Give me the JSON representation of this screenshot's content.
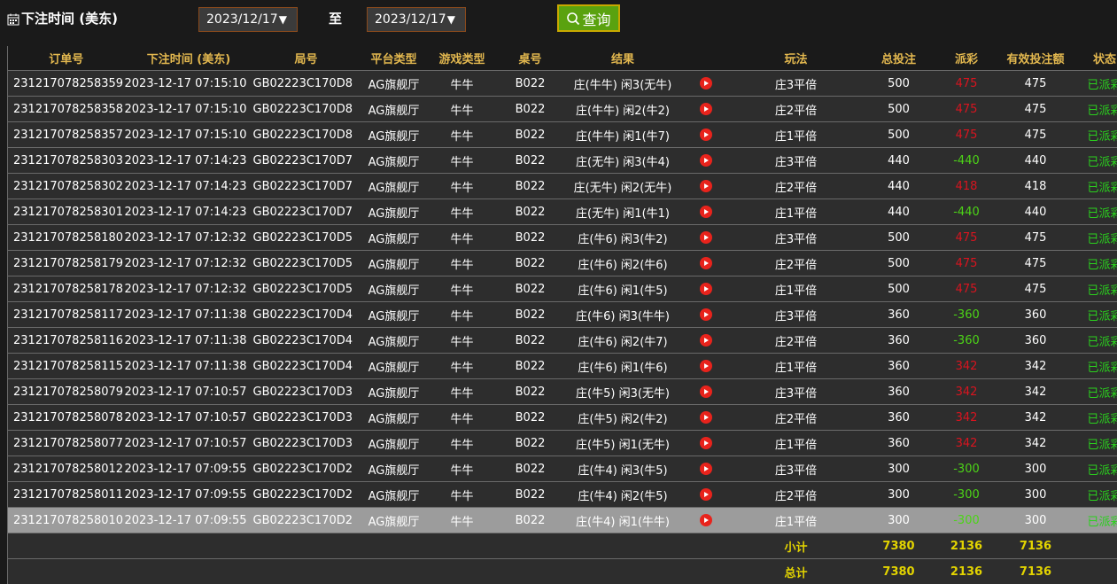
{
  "filter": {
    "label": "下注时间 (美东)",
    "start_date": "2023/12/17",
    "to_label": "至",
    "end_date": "2023/12/17",
    "query_label": "查询"
  },
  "table": {
    "headers": [
      "订单号",
      "下注时间 (美东)",
      "局号",
      "平台类型",
      "游戏类型",
      "桌号",
      "结果",
      "",
      "玩法",
      "总投注",
      "派彩",
      "有效投注额",
      "状态"
    ],
    "rows": [
      {
        "order": "231217078258359",
        "time": "2023-12-17 07:15:10",
        "round": "GB02223C170D8",
        "platform": "AG旗舰厅",
        "game": "牛牛",
        "table": "B022",
        "result": "庄(牛牛) 闲3(无牛)",
        "play": "庄3平倍",
        "bet": "500",
        "payout": "475",
        "valid": "475",
        "status": "已派彩"
      },
      {
        "order": "231217078258358",
        "time": "2023-12-17 07:15:10",
        "round": "GB02223C170D8",
        "platform": "AG旗舰厅",
        "game": "牛牛",
        "table": "B022",
        "result": "庄(牛牛) 闲2(牛2)",
        "play": "庄2平倍",
        "bet": "500",
        "payout": "475",
        "valid": "475",
        "status": "已派彩"
      },
      {
        "order": "231217078258357",
        "time": "2023-12-17 07:15:10",
        "round": "GB02223C170D8",
        "platform": "AG旗舰厅",
        "game": "牛牛",
        "table": "B022",
        "result": "庄(牛牛) 闲1(牛7)",
        "play": "庄1平倍",
        "bet": "500",
        "payout": "475",
        "valid": "475",
        "status": "已派彩"
      },
      {
        "order": "231217078258303",
        "time": "2023-12-17 07:14:23",
        "round": "GB02223C170D7",
        "platform": "AG旗舰厅",
        "game": "牛牛",
        "table": "B022",
        "result": "庄(无牛) 闲3(牛4)",
        "play": "庄3平倍",
        "bet": "440",
        "payout": "-440",
        "valid": "440",
        "status": "已派彩"
      },
      {
        "order": "231217078258302",
        "time": "2023-12-17 07:14:23",
        "round": "GB02223C170D7",
        "platform": "AG旗舰厅",
        "game": "牛牛",
        "table": "B022",
        "result": "庄(无牛) 闲2(无牛)",
        "play": "庄2平倍",
        "bet": "440",
        "payout": "418",
        "valid": "418",
        "status": "已派彩"
      },
      {
        "order": "231217078258301",
        "time": "2023-12-17 07:14:23",
        "round": "GB02223C170D7",
        "platform": "AG旗舰厅",
        "game": "牛牛",
        "table": "B022",
        "result": "庄(无牛) 闲1(牛1)",
        "play": "庄1平倍",
        "bet": "440",
        "payout": "-440",
        "valid": "440",
        "status": "已派彩"
      },
      {
        "order": "231217078258180",
        "time": "2023-12-17 07:12:32",
        "round": "GB02223C170D5",
        "platform": "AG旗舰厅",
        "game": "牛牛",
        "table": "B022",
        "result": "庄(牛6) 闲3(牛2)",
        "play": "庄3平倍",
        "bet": "500",
        "payout": "475",
        "valid": "475",
        "status": "已派彩"
      },
      {
        "order": "231217078258179",
        "time": "2023-12-17 07:12:32",
        "round": "GB02223C170D5",
        "platform": "AG旗舰厅",
        "game": "牛牛",
        "table": "B022",
        "result": "庄(牛6) 闲2(牛6)",
        "play": "庄2平倍",
        "bet": "500",
        "payout": "475",
        "valid": "475",
        "status": "已派彩"
      },
      {
        "order": "231217078258178",
        "time": "2023-12-17 07:12:32",
        "round": "GB02223C170D5",
        "platform": "AG旗舰厅",
        "game": "牛牛",
        "table": "B022",
        "result": "庄(牛6) 闲1(牛5)",
        "play": "庄1平倍",
        "bet": "500",
        "payout": "475",
        "valid": "475",
        "status": "已派彩"
      },
      {
        "order": "231217078258117",
        "time": "2023-12-17 07:11:38",
        "round": "GB02223C170D4",
        "platform": "AG旗舰厅",
        "game": "牛牛",
        "table": "B022",
        "result": "庄(牛6) 闲3(牛牛)",
        "play": "庄3平倍",
        "bet": "360",
        "payout": "-360",
        "valid": "360",
        "status": "已派彩"
      },
      {
        "order": "231217078258116",
        "time": "2023-12-17 07:11:38",
        "round": "GB02223C170D4",
        "platform": "AG旗舰厅",
        "game": "牛牛",
        "table": "B022",
        "result": "庄(牛6) 闲2(牛7)",
        "play": "庄2平倍",
        "bet": "360",
        "payout": "-360",
        "valid": "360",
        "status": "已派彩"
      },
      {
        "order": "231217078258115",
        "time": "2023-12-17 07:11:38",
        "round": "GB02223C170D4",
        "platform": "AG旗舰厅",
        "game": "牛牛",
        "table": "B022",
        "result": "庄(牛6) 闲1(牛6)",
        "play": "庄1平倍",
        "bet": "360",
        "payout": "342",
        "valid": "342",
        "status": "已派彩"
      },
      {
        "order": "231217078258079",
        "time": "2023-12-17 07:10:57",
        "round": "GB02223C170D3",
        "platform": "AG旗舰厅",
        "game": "牛牛",
        "table": "B022",
        "result": "庄(牛5) 闲3(无牛)",
        "play": "庄3平倍",
        "bet": "360",
        "payout": "342",
        "valid": "342",
        "status": "已派彩"
      },
      {
        "order": "231217078258078",
        "time": "2023-12-17 07:10:57",
        "round": "GB02223C170D3",
        "platform": "AG旗舰厅",
        "game": "牛牛",
        "table": "B022",
        "result": "庄(牛5) 闲2(牛2)",
        "play": "庄2平倍",
        "bet": "360",
        "payout": "342",
        "valid": "342",
        "status": "已派彩"
      },
      {
        "order": "231217078258077",
        "time": "2023-12-17 07:10:57",
        "round": "GB02223C170D3",
        "platform": "AG旗舰厅",
        "game": "牛牛",
        "table": "B022",
        "result": "庄(牛5) 闲1(无牛)",
        "play": "庄1平倍",
        "bet": "360",
        "payout": "342",
        "valid": "342",
        "status": "已派彩"
      },
      {
        "order": "231217078258012",
        "time": "2023-12-17 07:09:55",
        "round": "GB02223C170D2",
        "platform": "AG旗舰厅",
        "game": "牛牛",
        "table": "B022",
        "result": "庄(牛4) 闲3(牛5)",
        "play": "庄3平倍",
        "bet": "300",
        "payout": "-300",
        "valid": "300",
        "status": "已派彩"
      },
      {
        "order": "231217078258011",
        "time": "2023-12-17 07:09:55",
        "round": "GB02223C170D2",
        "platform": "AG旗舰厅",
        "game": "牛牛",
        "table": "B022",
        "result": "庄(牛4) 闲2(牛5)",
        "play": "庄2平倍",
        "bet": "300",
        "payout": "-300",
        "valid": "300",
        "status": "已派彩"
      },
      {
        "order": "231217078258010",
        "time": "2023-12-17 07:09:55",
        "round": "GB02223C170D2",
        "platform": "AG旗舰厅",
        "game": "牛牛",
        "table": "B022",
        "result": "庄(牛4) 闲1(牛牛)",
        "play": "庄1平倍",
        "bet": "300",
        "payout": "-300",
        "valid": "300",
        "status": "已派彩"
      }
    ],
    "selected_row_index": 17,
    "subtotal": {
      "label": "小计",
      "bet": "7380",
      "payout": "2136",
      "valid": "7136"
    },
    "total": {
      "label": "总计",
      "bet": "7380",
      "payout": "2136",
      "valid": "7136"
    }
  },
  "colors": {
    "header_text": "#e3b84f",
    "status_green": "#2ad11d",
    "payout_positive_red": "#d8141f",
    "payout_negative_green": "#4cd417",
    "summary_yellow": "#e3d400",
    "query_button_bg": "#5aa20f"
  },
  "icons": {
    "calendar": "calendar-icon",
    "search": "search-icon",
    "play": "play-video-icon",
    "dropdown": "triangle-down-icon"
  }
}
